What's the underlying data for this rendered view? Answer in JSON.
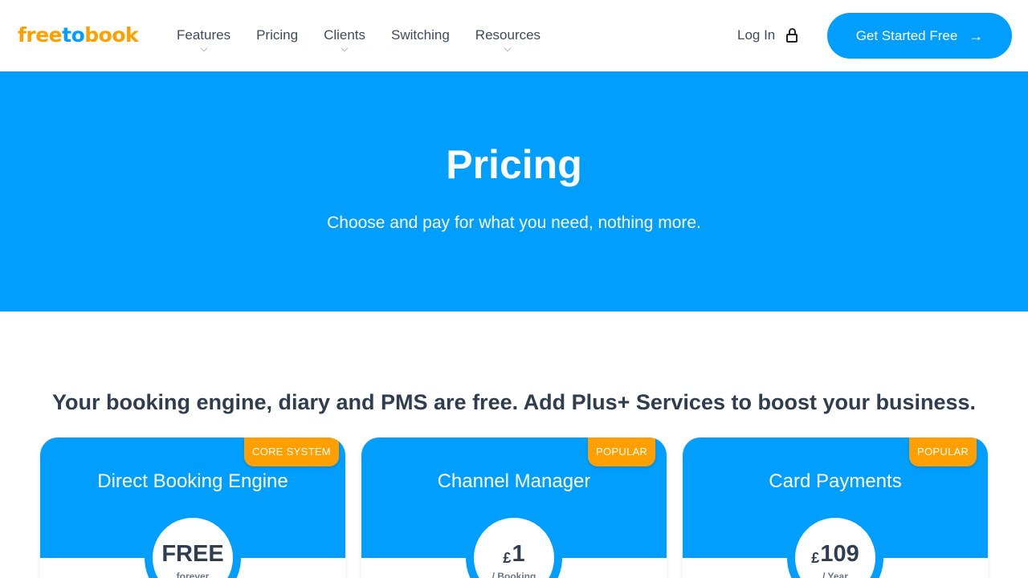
{
  "brand": {
    "part1": "free",
    "part2": "to",
    "part3": "book"
  },
  "nav": {
    "items": [
      {
        "label": "Features",
        "has_dropdown": true
      },
      {
        "label": "Pricing",
        "has_dropdown": false
      },
      {
        "label": "Clients",
        "has_dropdown": true
      },
      {
        "label": "Switching",
        "has_dropdown": false
      },
      {
        "label": "Resources",
        "has_dropdown": true
      }
    ],
    "login_label": "Log In",
    "cta_label": "Get Started Free",
    "cta_icon": "arrow-right-icon"
  },
  "hero": {
    "title": "Pricing",
    "subtitle": "Choose and pay for what you need, nothing more."
  },
  "section": {
    "heading": "Your booking engine, diary and PMS are free. Add Plus+ Services to boost your business."
  },
  "cards": [
    {
      "badge": "CORE SYSTEM",
      "title": "Direct Booking Engine",
      "currency": "",
      "price": "FREE",
      "period": "forever"
    },
    {
      "badge": "POPULAR",
      "title": "Channel Manager",
      "currency": "£",
      "price": "1",
      "period": "/ Booking"
    },
    {
      "badge": "POPULAR",
      "title": "Card Payments",
      "currency": "£",
      "price": "109",
      "period": "/ Year"
    }
  ],
  "colors": {
    "primary": "#009fff",
    "accent": "#ffa000",
    "text": "#2f3d4e"
  }
}
